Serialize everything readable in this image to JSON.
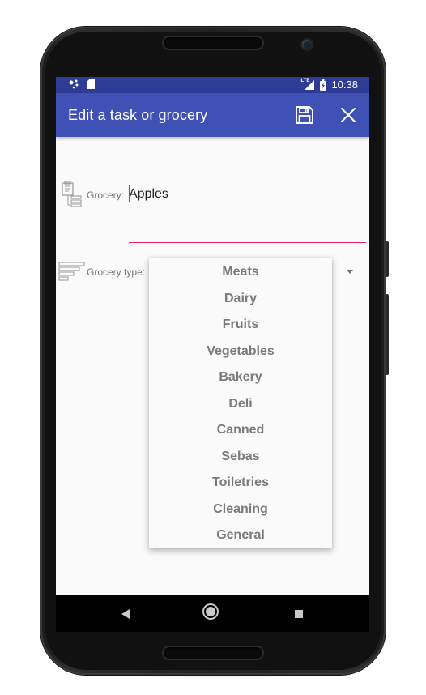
{
  "status_bar": {
    "time": "10:38",
    "network_label": "LTE",
    "icons": [
      "notification-dots-icon",
      "sd-card-icon",
      "signal-icon",
      "battery-icon"
    ]
  },
  "toolbar": {
    "title": "Edit a task or grocery",
    "save_icon": "save-icon",
    "close_icon": "close-icon"
  },
  "form": {
    "grocery_label": "Grocery:",
    "grocery_value": "Apples",
    "grocery_type_label": "Grocery type:"
  },
  "dropdown": {
    "options": [
      "Meats",
      "Dairy",
      "Fruits",
      "Vegetables",
      "Bakery",
      "Deli",
      "Canned",
      "Sebas",
      "Toiletries",
      "Cleaning",
      "General"
    ]
  },
  "nav_bar": {
    "icons": [
      "back-icon",
      "home-icon",
      "recent-apps-icon"
    ]
  },
  "colors": {
    "primary": "#3f51b5",
    "primary_dark": "#2f3c96",
    "accent": "#e91e63",
    "background": "#fafafa"
  }
}
